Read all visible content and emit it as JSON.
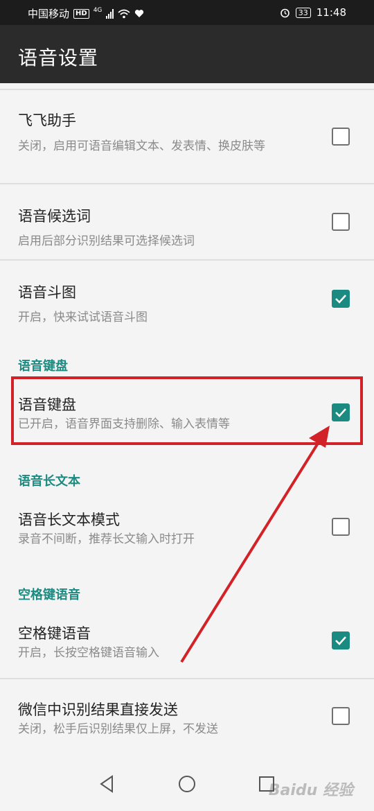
{
  "status_bar": {
    "carrier": "中国移动",
    "hd": "HD",
    "network": "4G",
    "battery": "33",
    "time": "11:48"
  },
  "app_bar": {
    "title": "语音设置"
  },
  "settings": {
    "feifei": {
      "title": "飞飞助手",
      "summary": "关闭，启用可语音编辑文本、发表情、换皮肤等",
      "checked": false
    },
    "candidates": {
      "title": "语音候选词",
      "summary": "启用后部分识别结果可选择候选词",
      "checked": false
    },
    "doutu": {
      "title": "语音斗图",
      "summary": "开启，快来试试语音斗图",
      "checked": true
    },
    "keyboard_section": "语音键盘",
    "keyboard": {
      "title": "语音键盘",
      "summary": "已开启，语音界面支持删除、输入表情等",
      "checked": true
    },
    "longtext_section": "语音长文本",
    "longtext": {
      "title": "语音长文本模式",
      "summary": "录音不间断，推荐长文输入时打开",
      "checked": false
    },
    "space_section": "空格键语音",
    "space": {
      "title": "空格键语音",
      "summary": "开启，长按空格键语音输入",
      "checked": true
    },
    "wechat": {
      "title": "微信中识别结果直接发送",
      "summary": "关闭，松手后识别结果仅上屏，不发送",
      "checked": false
    }
  },
  "annotation_color": "#d32227",
  "accent_color": "#1b8a80",
  "watermark": "Baidu 经验"
}
